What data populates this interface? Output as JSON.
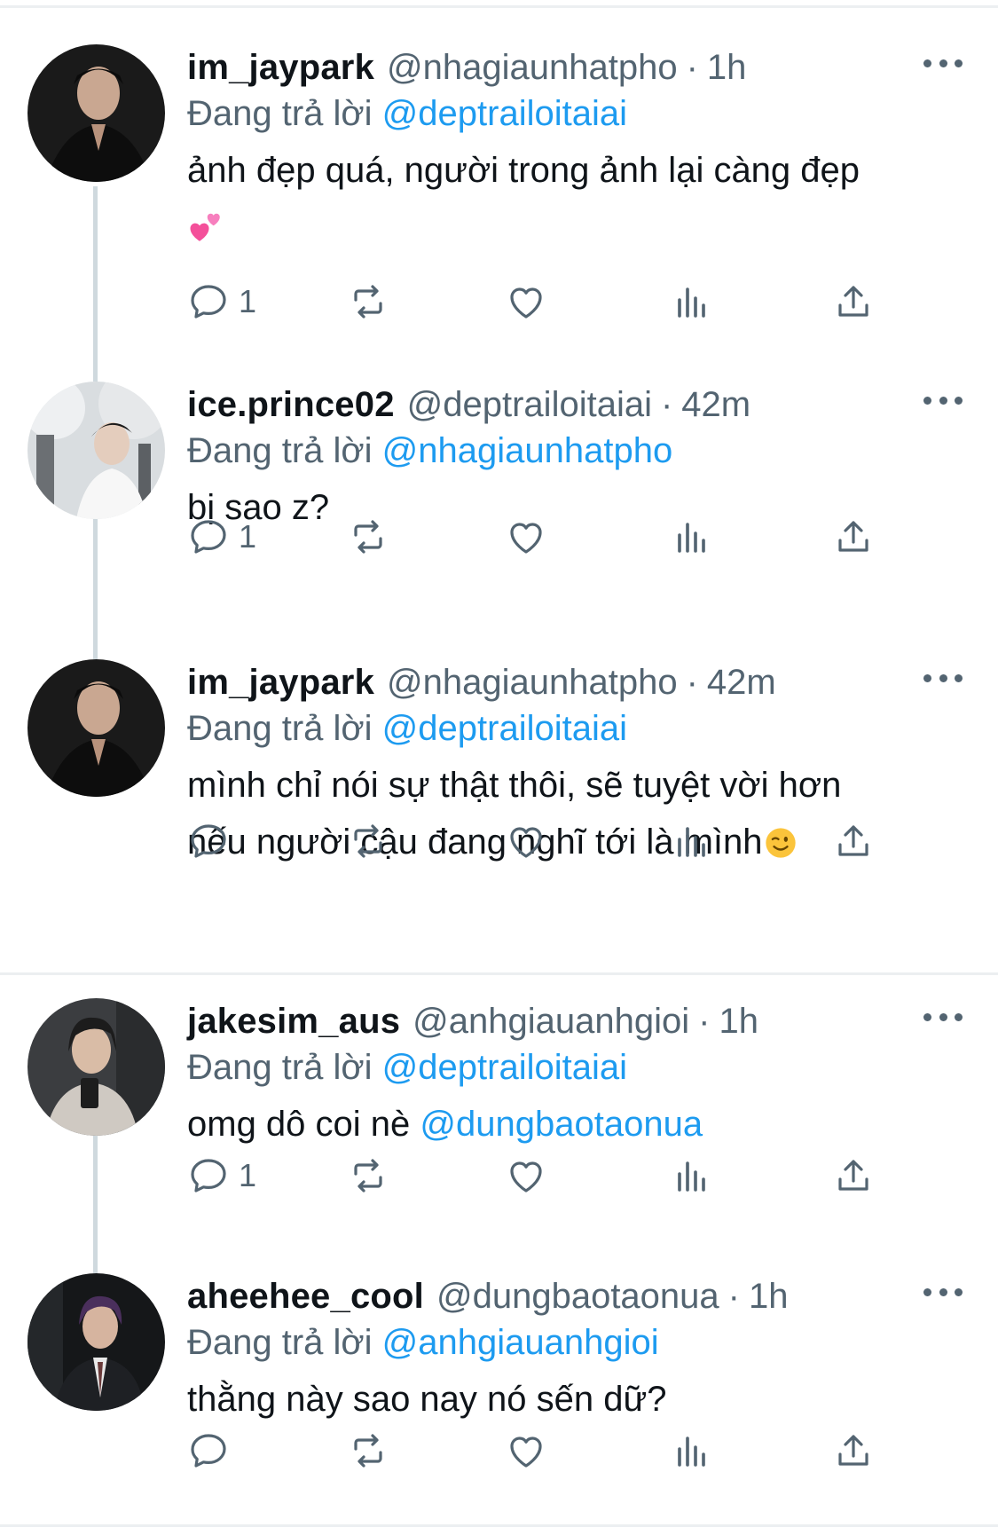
{
  "tweets": [
    {
      "name": "im_jaypark",
      "handle": "@nhagiaunhatpho",
      "time": "1h",
      "reply_prefix": "Đang trả lời",
      "reply_to": "@deptrailoitaiai",
      "text": "ảnh đẹp quá, người trong ảnh lại càng đẹp",
      "emoji": "two-hearts-emoji",
      "reply_count": "1",
      "avatar": "avatar-jaypark"
    },
    {
      "name": "ice.prince02",
      "handle": "@deptrailoitaiai",
      "time": "42m",
      "reply_prefix": "Đang trả lời",
      "reply_to": "@nhagiaunhatpho",
      "text": "bị sao z?",
      "reply_count": "1",
      "avatar": "avatar-iceprince"
    },
    {
      "name": "im_jaypark",
      "handle": "@nhagiaunhatpho",
      "time": "42m",
      "reply_prefix": "Đang trả lời",
      "reply_to": "@deptrailoitaiai",
      "text_line1": "mình chỉ nói sự thật thôi, sẽ tuyệt vời hơn",
      "text_line2": "nếu người cậu đang nghĩ tới là mình",
      "emoji": "wink-emoji",
      "reply_count": "",
      "avatar": "avatar-jaypark"
    },
    {
      "name": "jakesim_aus",
      "handle": "@anhgiauanhgioi",
      "time": "1h",
      "reply_prefix": "Đang trả lời",
      "reply_to": "@deptrailoitaiai",
      "text": "omg dô coi nè",
      "text_mention": "@dungbaotaonua",
      "reply_count": "1",
      "avatar": "avatar-jakesim"
    },
    {
      "name": "aheehee_cool",
      "handle": "@dungbaotaonua",
      "time": "1h",
      "reply_prefix": "Đang trả lời",
      "reply_to": "@anhgiauanhgioi",
      "text": "thằng này sao nay nó sến dữ?",
      "reply_count": "",
      "avatar": "avatar-aheehee"
    }
  ],
  "separator": "·",
  "icons": [
    "reply-icon",
    "retweet-icon",
    "like-icon",
    "views-icon",
    "share-icon",
    "more-icon"
  ],
  "colors": {
    "link": "#1d9bf0",
    "secondary": "#536471",
    "text": "#0f1419",
    "thread_line": "#cfd9de"
  }
}
